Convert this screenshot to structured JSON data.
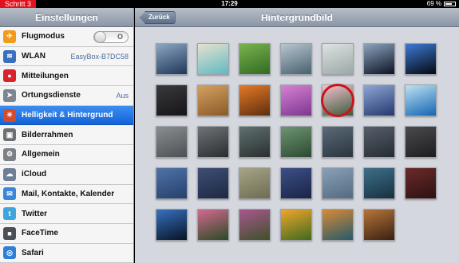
{
  "status_bar": {
    "step_label": "Schritt 3",
    "time": "17:29",
    "battery": "69 %"
  },
  "sidebar": {
    "title": "Einstellungen",
    "items": [
      {
        "label": "Flugmodus",
        "icon": "airplane-icon",
        "icon_color": "#f29a1b",
        "toggle": "O"
      },
      {
        "label": "WLAN",
        "icon": "wifi-icon",
        "icon_color": "#3a6fc0",
        "value": "EasyBox-B7DC58"
      },
      {
        "label": "Mitteilungen",
        "icon": "notifications-icon",
        "icon_color": "#d8242a"
      },
      {
        "label": "Ortungsdienste",
        "icon": "location-icon",
        "icon_color": "#7d8590",
        "value": "Aus"
      },
      {
        "label": "Helligkeit & Hintergrund",
        "icon": "brightness-icon",
        "icon_color": "#d44a2a",
        "selected": true
      },
      {
        "label": "Bilderrahmen",
        "icon": "picture-frame-icon",
        "icon_color": "#6b6e73"
      },
      {
        "label": "Allgemein",
        "icon": "gear-icon",
        "icon_color": "#7b7f86"
      },
      {
        "label": "iCloud",
        "icon": "cloud-icon",
        "icon_color": "#6d7f97"
      },
      {
        "label": "Mail, Kontakte, Kalender",
        "icon": "mail-icon",
        "icon_color": "#3a86d8"
      },
      {
        "label": "Twitter",
        "icon": "twitter-icon",
        "icon_color": "#3fa6dd"
      },
      {
        "label": "FaceTime",
        "icon": "facetime-icon",
        "icon_color": "#4b4f56"
      },
      {
        "label": "Safari",
        "icon": "safari-icon",
        "icon_color": "#2f7fd8"
      }
    ]
  },
  "detail": {
    "title": "Hintergrundbild",
    "back_label": "Zurück",
    "wallpapers": [
      {
        "name": "wallpaper-1",
        "colors": [
          "#8ea7c4",
          "#1f3658"
        ]
      },
      {
        "name": "wallpaper-2",
        "colors": [
          "#e7e1cd",
          "#5fb9c3"
        ]
      },
      {
        "name": "wallpaper-3",
        "colors": [
          "#7bb24e",
          "#2f6b21"
        ]
      },
      {
        "name": "wallpaper-4",
        "colors": [
          "#b9c6cf",
          "#47606f"
        ]
      },
      {
        "name": "wallpaper-5",
        "colors": [
          "#dde3e2",
          "#9aa8a6"
        ]
      },
      {
        "name": "wallpaper-6",
        "colors": [
          "#8ea3bf",
          "#0b1222"
        ]
      },
      {
        "name": "wallpaper-7",
        "colors": [
          "#3c7bd6",
          "#05080f"
        ]
      },
      {
        "name": "wallpaper-8",
        "colors": [
          "#3a3a3d",
          "#151517"
        ]
      },
      {
        "name": "wallpaper-9",
        "colors": [
          "#d4a161",
          "#8a5a28"
        ]
      },
      {
        "name": "wallpaper-10",
        "colors": [
          "#e57a26",
          "#5e2e10"
        ]
      },
      {
        "name": "wallpaper-11",
        "colors": [
          "#d782d3",
          "#7c3690"
        ]
      },
      {
        "name": "wallpaper-12",
        "colors": [
          "#f4c1d1",
          "#3c5a3a"
        ],
        "selected": true
      },
      {
        "name": "wallpaper-13",
        "colors": [
          "#8ea6d4",
          "#24386e"
        ]
      },
      {
        "name": "wallpaper-14",
        "colors": [
          "#bde2f3",
          "#1565b2"
        ]
      },
      {
        "name": "wallpaper-15",
        "colors": [
          "#8a8e91",
          "#4d5155"
        ]
      },
      {
        "name": "wallpaper-16",
        "colors": [
          "#6f7478",
          "#2a2d30"
        ]
      },
      {
        "name": "wallpaper-17",
        "colors": [
          "#627070",
          "#28302f"
        ]
      },
      {
        "name": "wallpaper-18",
        "colors": [
          "#6e9573",
          "#2b4a30"
        ]
      },
      {
        "name": "wallpaper-19",
        "colors": [
          "#5b6b78",
          "#2a343d"
        ]
      },
      {
        "name": "wallpaper-20",
        "colors": [
          "#56606b",
          "#262b31"
        ]
      },
      {
        "name": "wallpaper-21",
        "colors": [
          "#4b4b4e",
          "#1d1d20"
        ]
      },
      {
        "name": "wallpaper-22",
        "colors": [
          "#4f73a8",
          "#26406b"
        ]
      },
      {
        "name": "wallpaper-23",
        "colors": [
          "#3e4f74",
          "#1d2843"
        ]
      },
      {
        "name": "wallpaper-24",
        "colors": [
          "#a7a586",
          "#6d6b52"
        ]
      },
      {
        "name": "wallpaper-25",
        "colors": [
          "#3c4f86",
          "#1a2447"
        ]
      },
      {
        "name": "wallpaper-26",
        "colors": [
          "#8aa0b6",
          "#546a80"
        ]
      },
      {
        "name": "wallpaper-27",
        "colors": [
          "#3d6f8a",
          "#17303f"
        ]
      },
      {
        "name": "wallpaper-28",
        "colors": [
          "#6b2a2a",
          "#2d1212"
        ]
      },
      {
        "name": "wallpaper-29",
        "colors": [
          "#3772c0",
          "#071325"
        ]
      },
      {
        "name": "wallpaper-30",
        "colors": [
          "#d46a8f",
          "#2a4a25"
        ]
      },
      {
        "name": "wallpaper-31",
        "colors": [
          "#a9578f",
          "#3d5128"
        ]
      },
      {
        "name": "wallpaper-32",
        "colors": [
          "#f0a62a",
          "#3f6a1f"
        ]
      },
      {
        "name": "wallpaper-33",
        "colors": [
          "#d98a36",
          "#265a6a"
        ]
      },
      {
        "name": "wallpaper-34",
        "colors": [
          "#b5763a",
          "#3b1f12"
        ]
      }
    ]
  }
}
